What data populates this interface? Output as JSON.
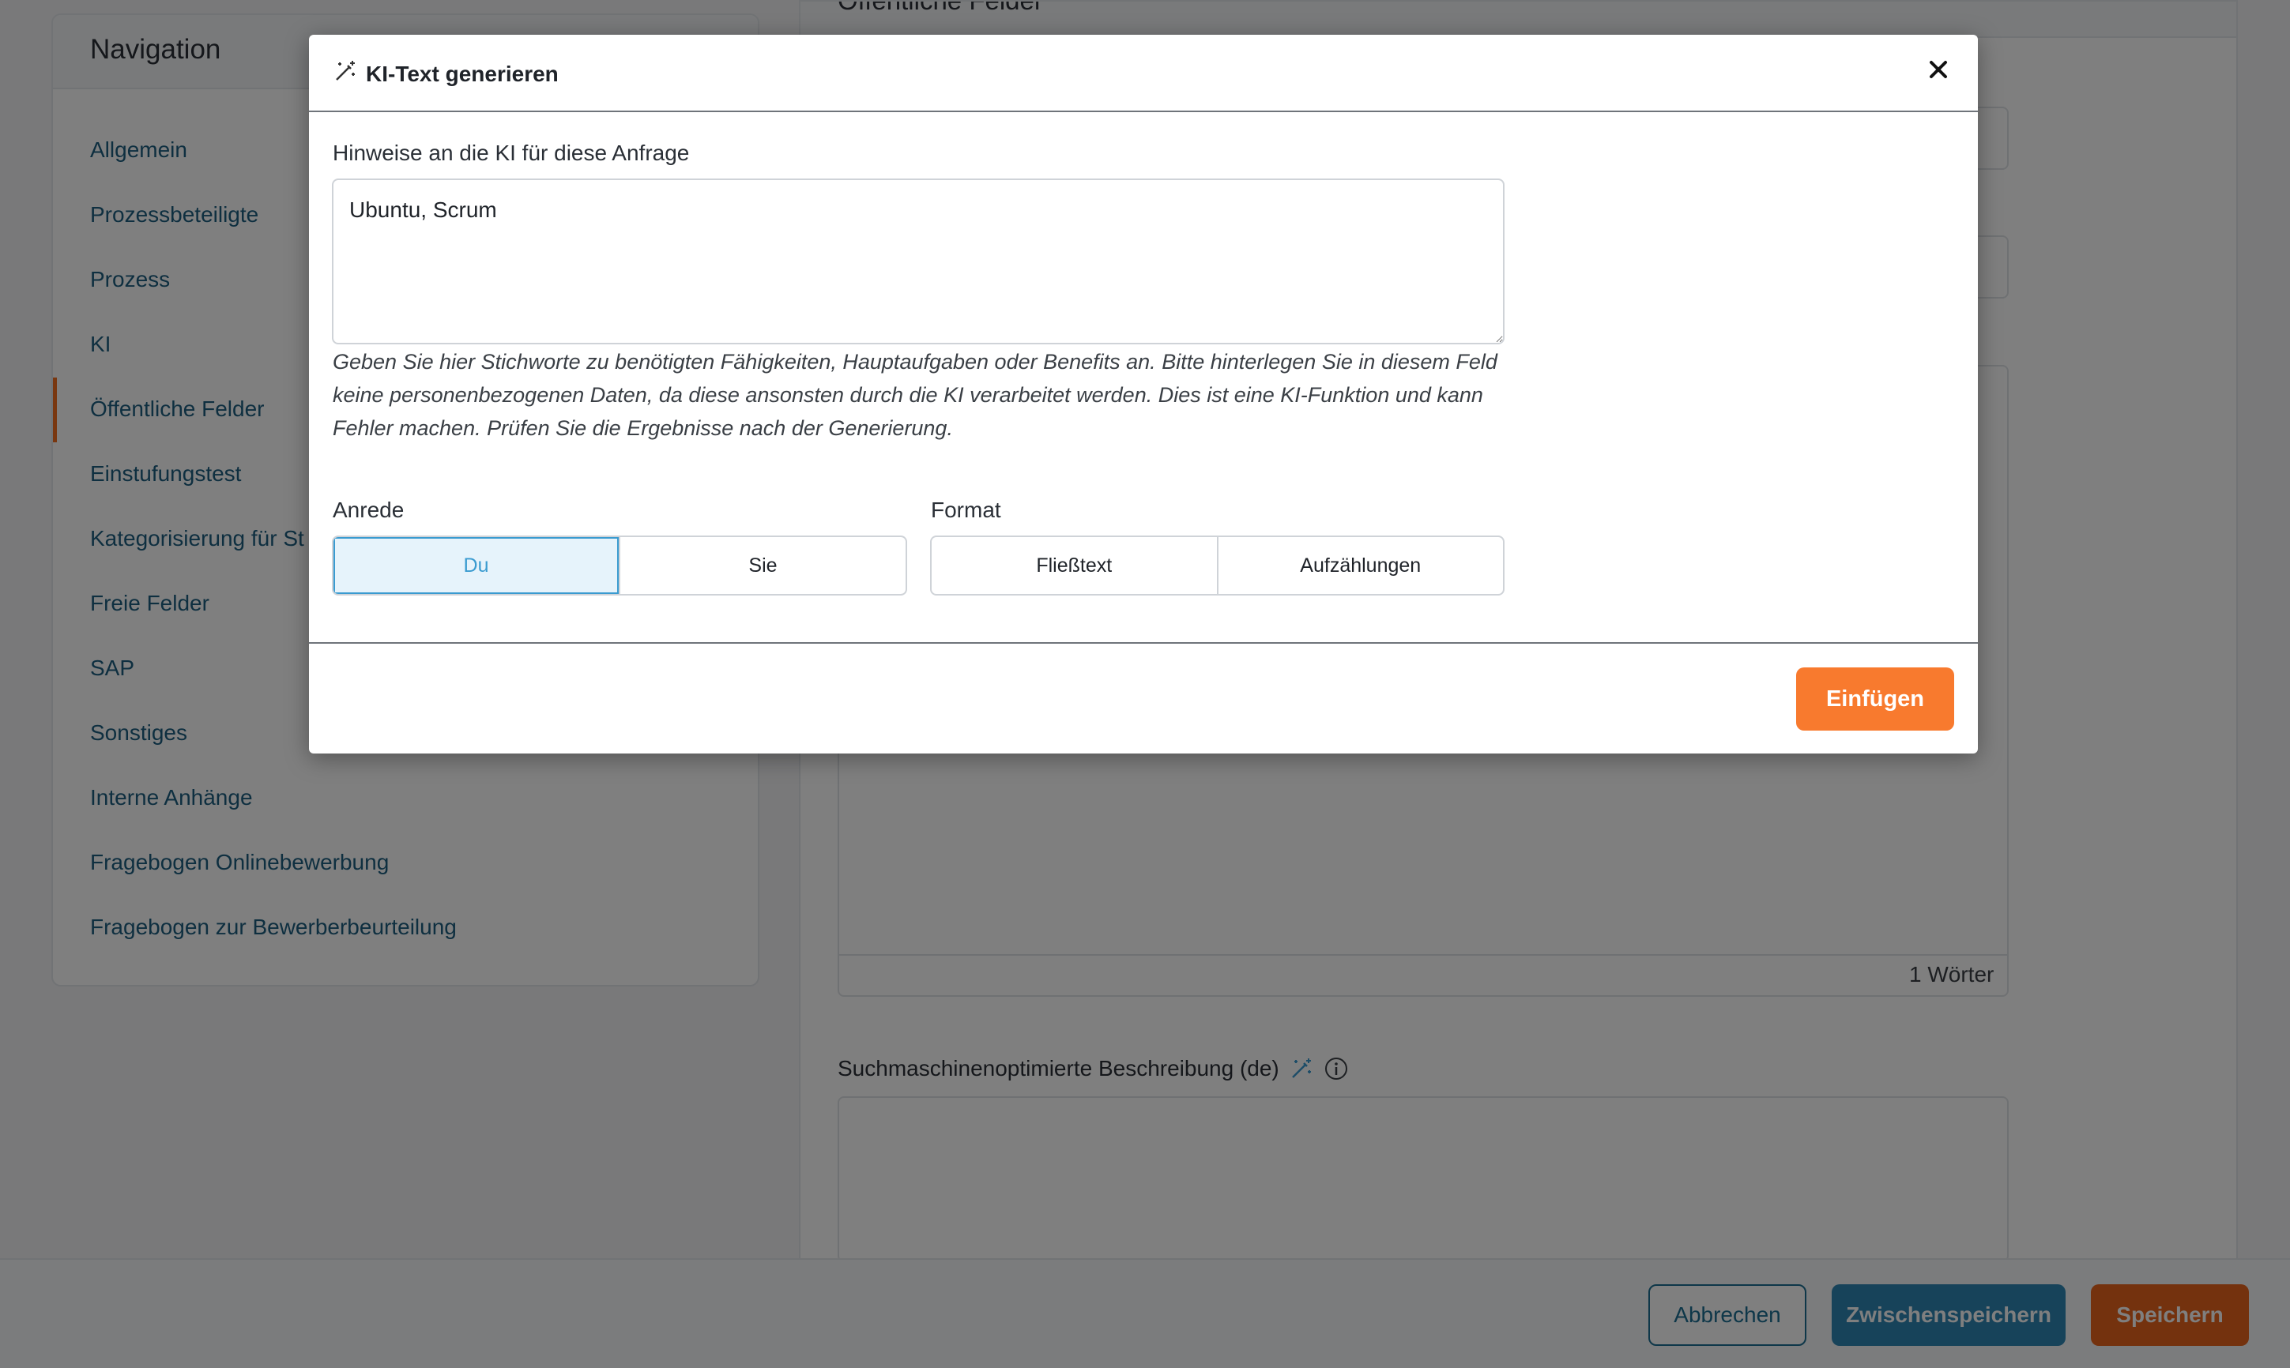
{
  "navigation": {
    "title": "Navigation",
    "items": [
      {
        "label": "Allgemein"
      },
      {
        "label": "Prozessbeteiligte"
      },
      {
        "label": "Prozess"
      },
      {
        "label": "KI"
      },
      {
        "label": "Öffentliche Felder",
        "active": true
      },
      {
        "label": "Einstufungstest"
      },
      {
        "label": "Kategorisierung für St"
      },
      {
        "label": "Freie Felder"
      },
      {
        "label": "SAP"
      },
      {
        "label": "Sonstiges"
      },
      {
        "label": "Interne Anhänge"
      },
      {
        "label": "Fragebogen Onlinebewerbung"
      },
      {
        "label": "Fragebogen zur Bewerberbeurteilung"
      }
    ]
  },
  "content": {
    "section_title": "Öffentliche Felder",
    "word_count": "1 Wörter",
    "seo_label": "Suchmaschinenoptimierte Beschreibung (de)"
  },
  "footer": {
    "cancel_label": "Abbrechen",
    "temp_save_label": "Zwischenspeichern",
    "save_label": "Speichern"
  },
  "modal": {
    "title": "KI-Text generieren",
    "hint_label": "Hinweise an die KI für diese Anfrage",
    "hint_value": "Ubuntu, Scrum",
    "hint_help": "Geben Sie hier Stichworte zu benötigten Fähigkeiten, Hauptaufgaben oder Benefits an. Bitte hinterlegen Sie in diesem Feld keine personenbezogenen Daten, da diese ansonsten durch die KI verarbeitet werden. Dies ist eine KI-Funktion und kann Fehler machen. Prüfen Sie die Ergebnisse nach der Generierung.",
    "salutation": {
      "label": "Anrede",
      "options": [
        "Du",
        "Sie"
      ],
      "selected": "Du"
    },
    "format": {
      "label": "Format",
      "options": [
        "Fließtext",
        "Aufzählungen"
      ],
      "selected": ""
    },
    "insert_label": "Einfügen"
  },
  "colors": {
    "accent": "#f87a2e",
    "link": "#1d5e80",
    "active_toggle": "#3a9bd0"
  },
  "icons": {
    "title_icon": "magic-wand-icon",
    "close": "close-icon",
    "info": "info-icon"
  }
}
